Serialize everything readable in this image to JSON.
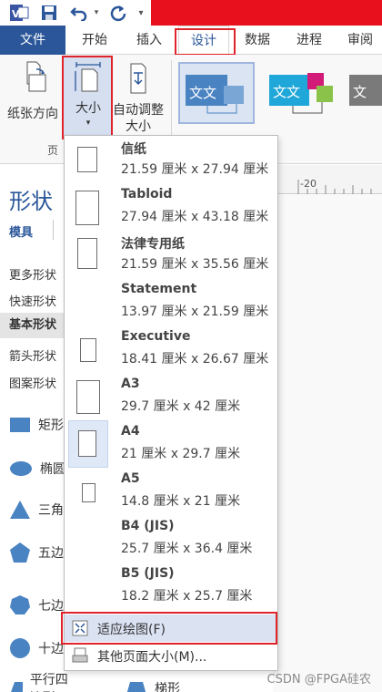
{
  "title_bar": {
    "app_icon": "visio-icon",
    "save_icon": "save-icon",
    "undo_icon": "undo-icon",
    "redo_icon": "redo-icon",
    "customize_icon": "customize-toolbar-icon",
    "accent_color": "#e8101c"
  },
  "ribbon_tabs": [
    {
      "label": "文件"
    },
    {
      "label": "开始"
    },
    {
      "label": "插入"
    },
    {
      "label": "设计"
    },
    {
      "label": "数据"
    },
    {
      "label": "进程"
    },
    {
      "label": "审阅"
    }
  ],
  "ribbon": {
    "orientation_label": "纸张方向",
    "size_label": "大小",
    "autofit_label_1": "自动调整",
    "autofit_label_2": "大小",
    "group_label": "页",
    "theme_text": "文文"
  },
  "shapes_panel": {
    "title": "形状",
    "subtitle": "模具",
    "stencils": [
      "更多形状",
      "快速形状",
      "基本形状",
      "箭头形状",
      "图案形状"
    ],
    "shapes": [
      "矩形",
      "椭圆",
      "三角",
      "五边",
      "七边",
      "十边",
      "平行四边形",
      "梯形"
    ]
  },
  "ruler": {
    "label": "-20"
  },
  "size_menu": {
    "items": [
      {
        "name": "信纸",
        "dims": "21.59 厘米 x 27.94 厘米"
      },
      {
        "name": "Tabloid",
        "dims": "27.94 厘米 x 43.18 厘米"
      },
      {
        "name": "法律专用纸",
        "dims": "21.59 厘米 x 35.56 厘米"
      },
      {
        "name": "Statement",
        "dims": "13.97 厘米 x 21.59 厘米"
      },
      {
        "name": "Executive",
        "dims": "18.41 厘米 x 26.67 厘米"
      },
      {
        "name": "A3",
        "dims": "29.7 厘米 x 42 厘米"
      },
      {
        "name": "A4",
        "dims": "21 厘米 x 29.7 厘米"
      },
      {
        "name": "A5",
        "dims": "14.8 厘米 x 21 厘米"
      },
      {
        "name": "B4 (JIS)",
        "dims": "25.7 厘米 x 36.4 厘米"
      },
      {
        "name": "B5 (JIS)",
        "dims": "18.2 厘米 x 25.7 厘米"
      }
    ],
    "fit_to_drawing": "适应绘图(F)",
    "more_sizes": "其他页面大小(M)..."
  },
  "watermark": "CSDN @FPGA硅农"
}
